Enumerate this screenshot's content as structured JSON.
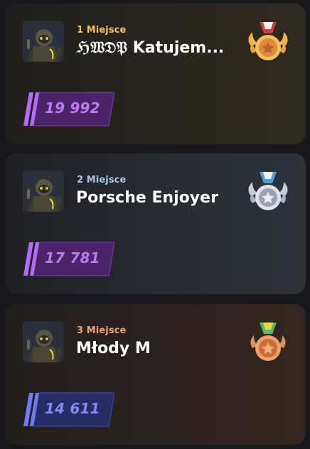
{
  "leaderboard": {
    "entries": [
      {
        "place_label": "1 Miejsce",
        "name": "ℌ𝔚𝔇𝔓 Katujem...",
        "score": "19 992",
        "medal": "gold-medal-icon",
        "avatar": "player-avatar"
      },
      {
        "place_label": "2 Miejsce",
        "name": "Porsche Enjoyer",
        "score": "17 781",
        "medal": "silver-medal-icon",
        "avatar": "player-avatar"
      },
      {
        "place_label": "3 Miejsce",
        "name": "Młody M",
        "score": "14 611",
        "medal": "bronze-medal-icon",
        "avatar": "player-avatar"
      }
    ]
  },
  "colors": {
    "gold_place": "#f5c25a",
    "silver_place": "#a6c6ee",
    "bronze_place": "#f0a27e",
    "score_purple": "#c079f3",
    "score_blue": "#7f8cf2"
  }
}
